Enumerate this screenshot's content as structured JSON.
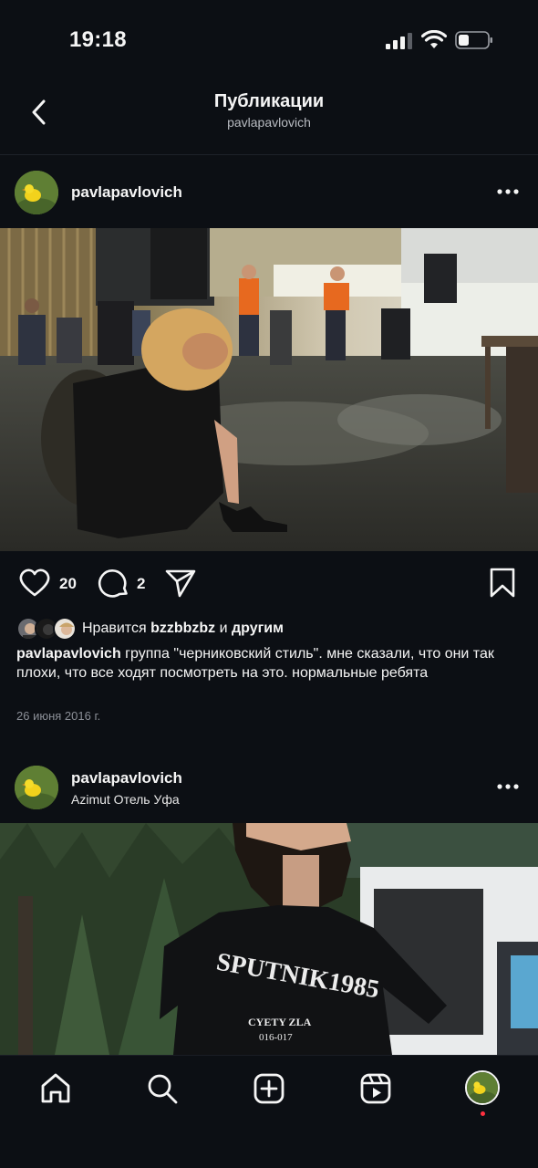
{
  "status_bar": {
    "time": "19:18"
  },
  "header": {
    "title": "Публикации",
    "subtitle": "pavlapavlovich"
  },
  "posts": [
    {
      "username": "pavlapavlovich",
      "likes_count": "20",
      "comments_count": "2",
      "likes_prefix": "Нравится",
      "likes_user": "bzzbbzbz",
      "likes_and": "и",
      "likes_others": "другим",
      "caption": "группа \"черниковский стиль\". мне сказали, что они так плохи, что все ходят посмотреть на это. нормальные ребята",
      "date": "26 июня 2016 г."
    },
    {
      "username": "pavlapavlovich",
      "location": "Azimut Отель Уфа",
      "shirt_text_main": "SPUTNIK1985",
      "shirt_text_sub1": "CYETY ZLA",
      "shirt_text_sub2": "016-017"
    }
  ],
  "icons": {
    "back": "chevron-left-icon",
    "more": "more-horizontal-icon",
    "like": "heart-icon",
    "comment": "comment-icon",
    "share": "send-icon",
    "save": "bookmark-icon",
    "home": "home-icon",
    "search": "search-icon",
    "create": "add-post-icon",
    "reels": "reels-icon",
    "profile": "profile-avatar-icon"
  },
  "colors": {
    "background": "#0c0f14",
    "text": "#f5f5f5",
    "secondary": "#8b8f97",
    "notification": "#ff3040"
  }
}
